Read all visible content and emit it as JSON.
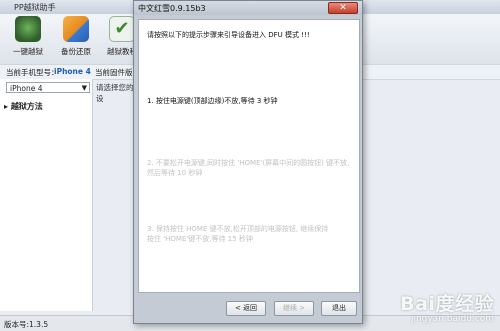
{
  "app": {
    "title": "PP越狱助手",
    "toolbar": [
      {
        "label": "一键越狱",
        "icon": "one-click-jailbreak-icon",
        "color": "#2f5d2b"
      },
      {
        "label": "备份还原",
        "icon": "backup-restore-icon",
        "color": "#e48a1e"
      },
      {
        "label": "越狱教程",
        "icon": "tutorial-icon",
        "color": "#4a8d3a"
      }
    ],
    "info": {
      "model_label": "当前手机型号：",
      "model_value": "iPhone 4",
      "firmware_label": "当前固件版本："
    },
    "device_select": "iPhone 4",
    "sidebar_item": "越狱方法",
    "main_field": "请选择您的设",
    "status": "版本号:1.3.5"
  },
  "dialog": {
    "title": "中文红雪0.9.15b3",
    "intro": "请按照以下的提示步骤来引导设备进入 DFU 模式 !!!",
    "step1": "1. 按住电源键(顶部边缘)不放,等待 3  秒钟",
    "step2_line1": "2. 不要松开电源键,同时按住 'HOME'(屏幕中间的圆按钮) 键不放,",
    "step2_line2": "然后等待 10  秒钟",
    "step3_line1": "3. 保持按住 HOME 键不放,松开顶部的电源按钮, 继续保持",
    "step3_line2": "按住 'HOME'键不放,等待 15 秒钟",
    "back": "< 返回",
    "next": "继续 >",
    "exit": "退出"
  },
  "watermark": {
    "main": "Bai度经验",
    "sub": "jingyan.baidu.com"
  }
}
